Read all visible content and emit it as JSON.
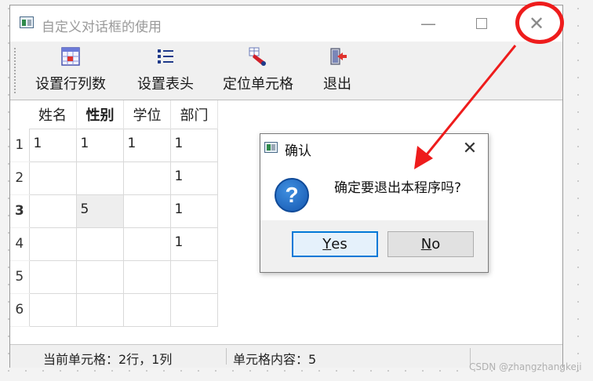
{
  "window": {
    "title": "自定义对话框的使用",
    "controls": {
      "minimize": "—",
      "close": "✕"
    }
  },
  "toolbar": {
    "items": [
      {
        "label": "设置行列数",
        "icon": "grid-settings-icon"
      },
      {
        "label": "设置表头",
        "icon": "list-header-icon"
      },
      {
        "label": "定位单元格",
        "icon": "locate-cell-icon"
      },
      {
        "label": "退出",
        "icon": "exit-door-icon"
      }
    ]
  },
  "table": {
    "columns": [
      "姓名",
      "性别",
      "学位",
      "部门"
    ],
    "row_headers": [
      "1",
      "2",
      "3",
      "4",
      "5",
      "6"
    ],
    "rows": [
      [
        "1",
        "1",
        "1",
        "1"
      ],
      [
        "",
        "",
        "",
        "1"
      ],
      [
        "",
        "5",
        "",
        "1"
      ],
      [
        "",
        "",
        "",
        "1"
      ],
      [
        "",
        "",
        "",
        ""
      ],
      [
        "",
        "",
        "",
        ""
      ]
    ],
    "current_row_index": 2,
    "current_col_index": 1
  },
  "status": {
    "current_cell": "当前单元格：2行，1列",
    "cell_content": "单元格内容：5"
  },
  "dialog": {
    "title": "确认",
    "icon": "question-icon",
    "message": "确定要退出本程序吗?",
    "buttons": [
      {
        "label_underlined": "Y",
        "label_rest": "es"
      },
      {
        "label_underlined": "N",
        "label_rest": "o"
      }
    ],
    "close": "✕"
  },
  "watermark": "CSDN @zhangzhangkeji",
  "colors": {
    "annotation": "#ee1c1c",
    "dialog_default_border": "#0078d7",
    "question_icon": "#1557b0"
  }
}
